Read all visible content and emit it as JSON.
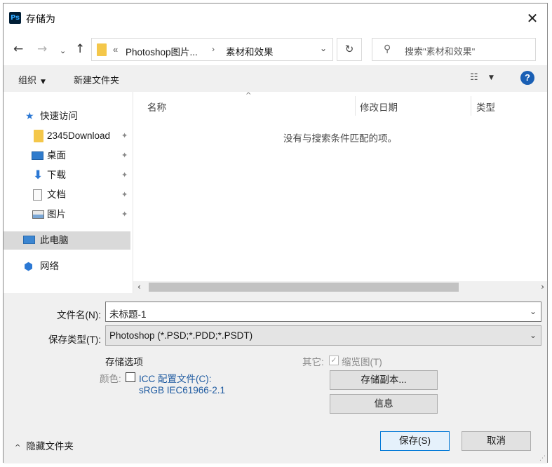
{
  "window": {
    "app_icon": "Ps",
    "title": "存储为",
    "close_glyph": "✕"
  },
  "nav_buttons": {
    "back": "←",
    "forward": "→",
    "recent": "⌄",
    "up": "↑"
  },
  "address": {
    "more": "«",
    "crumbs": [
      "Photoshop图片...",
      "素材和效果"
    ],
    "separator": "›",
    "dropdown": "⌄"
  },
  "refresh_glyph": "↻",
  "search": {
    "icon_glyph": "⚲",
    "placeholder": "搜索\"素材和效果\""
  },
  "toolbar": {
    "organize": "组织",
    "organize_caret": "▼",
    "new_folder": "新建文件夹",
    "view_glyph": "☷",
    "view_caret": "▼",
    "help": "?"
  },
  "navpane": {
    "quick_access": "快速访问",
    "items": [
      {
        "label": "2345Download",
        "pinned": true
      },
      {
        "label": "桌面",
        "pinned": true
      },
      {
        "label": "下载",
        "pinned": true
      },
      {
        "label": "文档",
        "pinned": true
      },
      {
        "label": "图片",
        "pinned": true
      }
    ],
    "this_pc": "此电脑",
    "network": "网络",
    "pin_glyph": "📌"
  },
  "filelist": {
    "sort_glyph": "^",
    "columns": [
      "名称",
      "修改日期",
      "类型"
    ],
    "empty_message": "没有与搜索条件匹配的项。"
  },
  "hscroll": {
    "left": "‹",
    "right": "›"
  },
  "form": {
    "filename_label": "文件名(N):",
    "filename_value": "未标题-1",
    "filetype_label": "保存类型(T):",
    "filetype_value": "Photoshop (*.PSD;*.PDD;*.PSDT)",
    "dropdown": "⌄",
    "save_options": "存储选项",
    "color_label": "颜色:",
    "icc_label": "ICC 配置文件(C):",
    "icc_checked": false,
    "icc_profile": "sRGB IEC61966-2.1",
    "other_label": "其它:",
    "thumbnail_label": "缩览图(T)",
    "thumbnail_checked": true,
    "save_copy_button": "存储副本...",
    "info_button": "信息",
    "save_button": "保存(S)",
    "cancel_button": "取消",
    "hide_folders": "隐藏文件夹",
    "hide_folders_glyph": "^"
  }
}
